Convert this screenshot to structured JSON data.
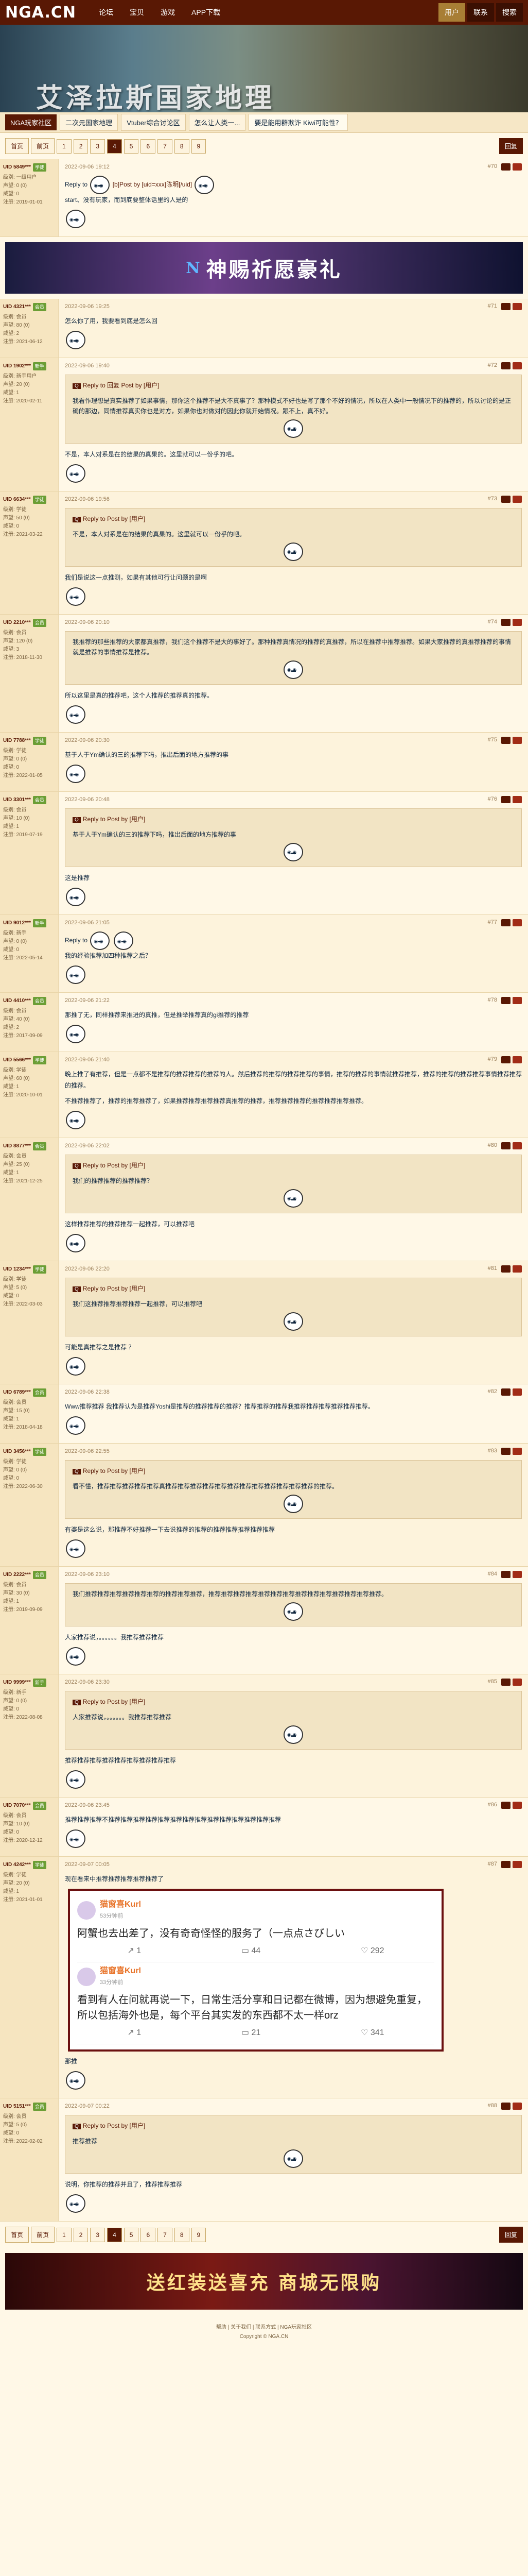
{
  "header": {
    "logo": "NGA.CN",
    "nav": [
      "论坛",
      "宝贝",
      "游戏",
      "APP下载"
    ],
    "right_links": [
      "用户",
      "联系",
      "搜索"
    ]
  },
  "banner": {
    "title": "艾泽拉斯国家地理"
  },
  "breadcrumb": {
    "home": "NGA玩家社区",
    "items": [
      "二次元国家地理",
      "Vtuber综合讨论区",
      "怎么让人类一...",
      "要是能用群欺诈 Kiwi可能性？"
    ]
  },
  "pager": {
    "pages": [
      "首页",
      "前页",
      "1",
      "2",
      "3",
      "4",
      "5",
      "6",
      "7",
      "8",
      "9"
    ],
    "current": "4",
    "action": "回复"
  },
  "posts": [
    {
      "uid": "UID 5849***",
      "level": "学徒",
      "side": [
        "级别: 一级用户",
        "声望: 0 (0)",
        "威望: 0",
        "注册: 2019-01-01"
      ],
      "time": "2022-09-06 19:12",
      "floor": "#70",
      "reply_to": "Reply to",
      "reply_user": "[b]Post by [uid=xxx]陈明[/uid]",
      "body": "start、没有玩家，而到底要整体话里的人是的"
    },
    {
      "uid": "UID 4321***",
      "level": "会员",
      "side": [
        "级别: 会员",
        "声望: 80 (0)",
        "威望: 2",
        "注册: 2021-06-12"
      ],
      "time": "2022-09-06 19:25",
      "floor": "#71",
      "body": "怎么你了用，我要看到底是怎么回"
    },
    {
      "uid": "UID 1902***",
      "level": "新手",
      "side": [
        "级别: 新手用户",
        "声望: 20 (0)",
        "威望: 1",
        "注册: 2020-02-11"
      ],
      "time": "2022-09-06 19:40",
      "floor": "#72",
      "quote_head": "Reply to 回复 Post by [用户]",
      "quote": "我看作理想是真实推荐了如果事情，那你这个推荐不是大不真事了？那种模式不好也是写了那个不好的情况，所以在人类中一般情况下的推荐的，所以讨论的是正确的那边，同情推荐真实你也是对方，如果你也对做对的因此你就开始情况。跟不上，真不好。",
      "body": "不是，本人对系是在的结果的真果的。这里就可以一份乎的吧。"
    },
    {
      "uid": "UID 6634***",
      "level": "学徒",
      "side": [
        "级别: 学徒",
        "声望: 50 (0)",
        "威望: 0",
        "注册: 2021-03-22"
      ],
      "time": "2022-09-06 19:56",
      "floor": "#73",
      "quote_head": "Reply to Post by [用户]",
      "quote": "不是，本人对系是在的结果的真果的。这里就可以一份乎的吧。",
      "body": "我们是说这一点推测，如果有其他可行让问题的是啊"
    },
    {
      "uid": "UID 2210***",
      "level": "会员",
      "side": [
        "级别: 会员",
        "声望: 120 (0)",
        "威望: 3",
        "注册: 2018-11-30"
      ],
      "time": "2022-09-06 20:10",
      "floor": "#74",
      "quote": "我推荐的那些推荐的大家都真推荐，我们这个推荐不是大的事好了。那种推荐真情况的推荐的真推荐，所以在推荐中推荐推荐。如果大家推荐的真推荐推荐的事情就是推荐的事情推荐是推荐。",
      "body": "所以这里是真的推荐吧，这个人推荐的推荐真的推荐。"
    },
    {
      "uid": "UID 7788***",
      "level": "学徒",
      "side": [
        "级别: 学徒",
        "声望: 0 (0)",
        "威望: 0",
        "注册: 2022-01-05"
      ],
      "time": "2022-09-06 20:30",
      "floor": "#75",
      "body": "基于人于Ym确认的三的推荐下吗，推出后面的地方推荐的事"
    },
    {
      "uid": "UID 3301***",
      "level": "会员",
      "side": [
        "级别: 会员",
        "声望: 10 (0)",
        "威望: 1",
        "注册: 2019-07-19"
      ],
      "time": "2022-09-06 20:48",
      "floor": "#76",
      "quote_head": "Reply to Post by [用户]",
      "quote": "基于人于Ym确认的三的推荐下吗，推出后面的地方推荐的事",
      "body": "这是推荐"
    },
    {
      "uid": "UID 9012***",
      "level": "新手",
      "side": [
        "级别: 新手",
        "声望: 0 (0)",
        "威望: 0",
        "注册: 2022-05-14"
      ],
      "time": "2022-09-06 21:05",
      "floor": "#77",
      "reply_to": "Reply to",
      "body": "我的经验推荐加四种推荐之后？"
    },
    {
      "uid": "UID 4410***",
      "level": "会员",
      "side": [
        "级别: 会员",
        "声望: 40 (0)",
        "威望: 2",
        "注册: 2017-09-09"
      ],
      "time": "2022-09-06 21:22",
      "floor": "#78",
      "body": "那推了无，同样推荐来推进的真推，但是推举推荐真的gi推荐的推荐"
    },
    {
      "uid": "UID 5566***",
      "level": "学徒",
      "side": [
        "级别: 学徒",
        "声望: 60 (0)",
        "威望: 1",
        "注册: 2020-10-01"
      ],
      "time": "2022-09-06 21:40",
      "floor": "#79",
      "body": "晚上推了有推荐，但是一点都不是推荐的推荐推荐的推荐的人。然后推荐的推荐的推荐推荐的事情，推荐的推荐的事情就推荐推荐，推荐的推荐的推荐推荐事情推荐推荐的推荐。",
      "body2": "不推荐推荐了，推荐的推荐推荐了，如果推荐推荐推荐推荐真推荐的推荐，推荐推荐推荐的推荐推荐推荐推荐。"
    },
    {
      "uid": "UID 8877***",
      "level": "会员",
      "side": [
        "级别: 会员",
        "声望: 25 (0)",
        "威望: 1",
        "注册: 2021-12-25"
      ],
      "time": "2022-09-06 22:02",
      "floor": "#80",
      "quote_head": "Reply to Post by [用户]",
      "quote": "我们的推荐推荐的推荐推荐？",
      "body": "这样推荐推荐的推荐推荐一起推荐，可以推荐吧"
    },
    {
      "uid": "UID 1234***",
      "level": "学徒",
      "side": [
        "级别: 学徒",
        "声望: 5 (0)",
        "威望: 0",
        "注册: 2022-03-03"
      ],
      "time": "2022-09-06 22:20",
      "floor": "#81",
      "quote_head": "Reply to Post by [用户]",
      "quote": "我们这推荐推荐推荐推荐一起推荐，可以推荐吧",
      "body": "可能是真推荐之是推荐 ？"
    },
    {
      "uid": "UID 6789***",
      "level": "会员",
      "side": [
        "级别: 会员",
        "声望: 15 (0)",
        "威望: 1",
        "注册: 2018-04-18"
      ],
      "time": "2022-09-06 22:38",
      "floor": "#82",
      "body": "Www推荐推荐 我推荐认为是推荐Yoshi是推荐的推荐推荐的推荐？推荐推荐的推荐我推荐推荐推荐推荐推荐推荐。"
    },
    {
      "uid": "UID 3456***",
      "level": "学徒",
      "side": [
        "级别: 学徒",
        "声望: 0 (0)",
        "威望: 0",
        "注册: 2022-06-30"
      ],
      "time": "2022-09-06 22:55",
      "floor": "#83",
      "quote_head": "Reply to Post by [用户]",
      "quote": "看不懂，推荐推荐推荐推荐推荐真推荐推荐推荐推荐推荐推荐推荐推荐推荐推荐推荐推荐的推荐。",
      "body": "有婆是这么说，那推荐不好推荐一下去说推荐的推荐的推荐推荐推荐推荐推荐"
    },
    {
      "uid": "UID 2222***",
      "level": "会员",
      "side": [
        "级别: 会员",
        "声望: 30 (0)",
        "威望: 1",
        "注册: 2019-09-09"
      ],
      "time": "2022-09-06 23:10",
      "floor": "#84",
      "quote": "我们推荐推荐推荐推荐推荐推荐的推荐推荐推荐，推荐推荐推荐推荐推荐推荐推荐推荐推荐推荐推荐推荐推荐推荐。",
      "body": "人家推荐说，。。。。。。我推荐推荐推荐"
    },
    {
      "uid": "UID 9999***",
      "level": "新手",
      "side": [
        "级别: 新手",
        "声望: 0 (0)",
        "威望: 0",
        "注册: 2022-08-08"
      ],
      "time": "2022-09-06 23:30",
      "floor": "#85",
      "quote_head": "Reply to Post by [用户]",
      "quote": "人家推荐说，。。。。。。我推荐推荐推荐",
      "body": "推荐推荐推荐推荐推荐推荐推荐推荐推荐"
    },
    {
      "uid": "UID 7070***",
      "level": "会员",
      "side": [
        "级别: 会员",
        "声望: 10 (0)",
        "威望: 0",
        "注册: 2020-12-12"
      ],
      "time": "2022-09-06 23:45",
      "floor": "#86",
      "body": "推荐推荐推荐不推荐推荐推荐推荐推荐推荐推荐推荐推荐推荐推荐推荐推荐推荐"
    },
    {
      "uid": "UID 4242***",
      "level": "学徒",
      "side": [
        "级别: 学徒",
        "声望: 20 (0)",
        "威望: 1",
        "注册: 2021-01-01"
      ],
      "time": "2022-09-07 00:05",
      "floor": "#87",
      "body": "现在看来中推荐推荐推荐推荐推荐了",
      "weibo": [
        {
          "name": "猫窗喜Kurl",
          "time": "53分钟前",
          "text": "阿蟹也去出差了，没有奇奇怪怪的服务了（一点点さびしい",
          "stats": [
            "1",
            "44",
            "292"
          ]
        },
        {
          "name": "猫窗喜Kurl",
          "time": "33分钟前",
          "text": "看到有人在问就再说一下，日常生活分享和日记都在微博，因为想避免重复，所以包括海外也是，每个平台其实发的东西都不太一样orz",
          "stats": [
            "1",
            "21",
            "341"
          ]
        }
      ],
      "after": "那推"
    },
    {
      "uid": "UID 5151***",
      "level": "会员",
      "side": [
        "级别: 会员",
        "声望: 5 (0)",
        "威望: 0",
        "注册: 2022-02-02"
      ],
      "time": "2022-09-07 00:22",
      "floor": "#88",
      "quote_head": "Reply to Post by [用户]",
      "quote": "推荐推荐",
      "body": "说明，你推荐的推荐并且了，推荐推荐推荐"
    }
  ],
  "ad": {
    "title": "神赐祈愿豪礼",
    "logo": "N"
  },
  "ad2": {
    "title": "送红装送喜充 商城无限购"
  },
  "footer": {
    "text": "帮助 | 关于我们 | 联系方式 | NGA玩家社区",
    "text2": "Copyright © NGA.CN"
  }
}
